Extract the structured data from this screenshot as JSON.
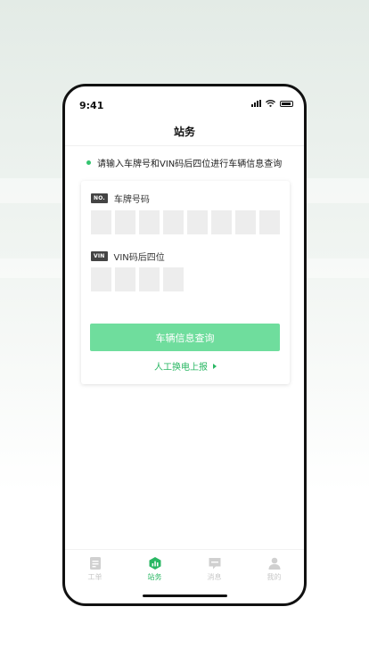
{
  "status_bar": {
    "time": "9:41"
  },
  "header": {
    "title": "站务"
  },
  "tip": {
    "text": "请输入车牌号和VIN码后四位进行车辆信息查询"
  },
  "plate": {
    "tag": "NO.",
    "label": "车牌号码",
    "cells": 8
  },
  "vin": {
    "tag": "VIN",
    "label": "VIN码后四位",
    "cells": 4
  },
  "actions": {
    "query_label": "车辆信息查询",
    "manual_label": "人工换电上报"
  },
  "tabs": [
    {
      "label": "工单",
      "icon": "document-icon",
      "active": false
    },
    {
      "label": "站务",
      "icon": "station-icon",
      "active": true
    },
    {
      "label": "消息",
      "icon": "message-icon",
      "active": false
    },
    {
      "label": "我的",
      "icon": "user-icon",
      "active": false
    }
  ],
  "colors": {
    "accent": "#29b763",
    "button": "#6fdd9d",
    "inactive_tab": "#c8c8c8"
  }
}
